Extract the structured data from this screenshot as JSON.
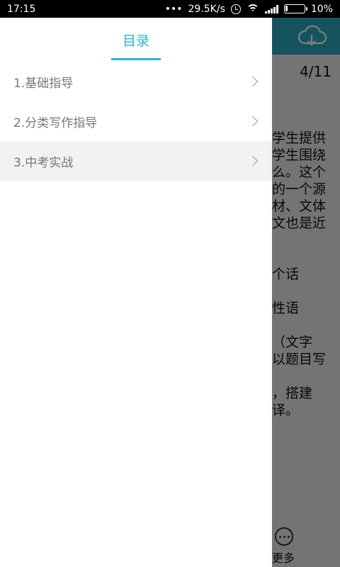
{
  "status_bar": {
    "time": "17:15",
    "dots": "•••",
    "speed": "29.5K/s",
    "battery": "10%",
    "battery_level": 0.1
  },
  "reader": {
    "page_indicator": "4/11",
    "text_lines": [
      "学生提供",
      "学生围绕",
      "么。这个",
      "的一个源",
      "材、文体",
      "文也是近",
      "",
      "",
      "个话",
      "",
      "性语",
      "",
      "（文字",
      "以题目写",
      "",
      "，搭建",
      "译。"
    ],
    "more_label": "更多"
  },
  "drawer": {
    "title": "目录",
    "items": [
      {
        "label": "1.基础指导",
        "active": false
      },
      {
        "label": "2.分类写作指导",
        "active": false
      },
      {
        "label": "3.中考实战",
        "active": true
      }
    ]
  },
  "colors": {
    "accent": "#2ab5cf",
    "header_bg": "#2aa9bd",
    "active_bg": "#f2f2f2"
  }
}
